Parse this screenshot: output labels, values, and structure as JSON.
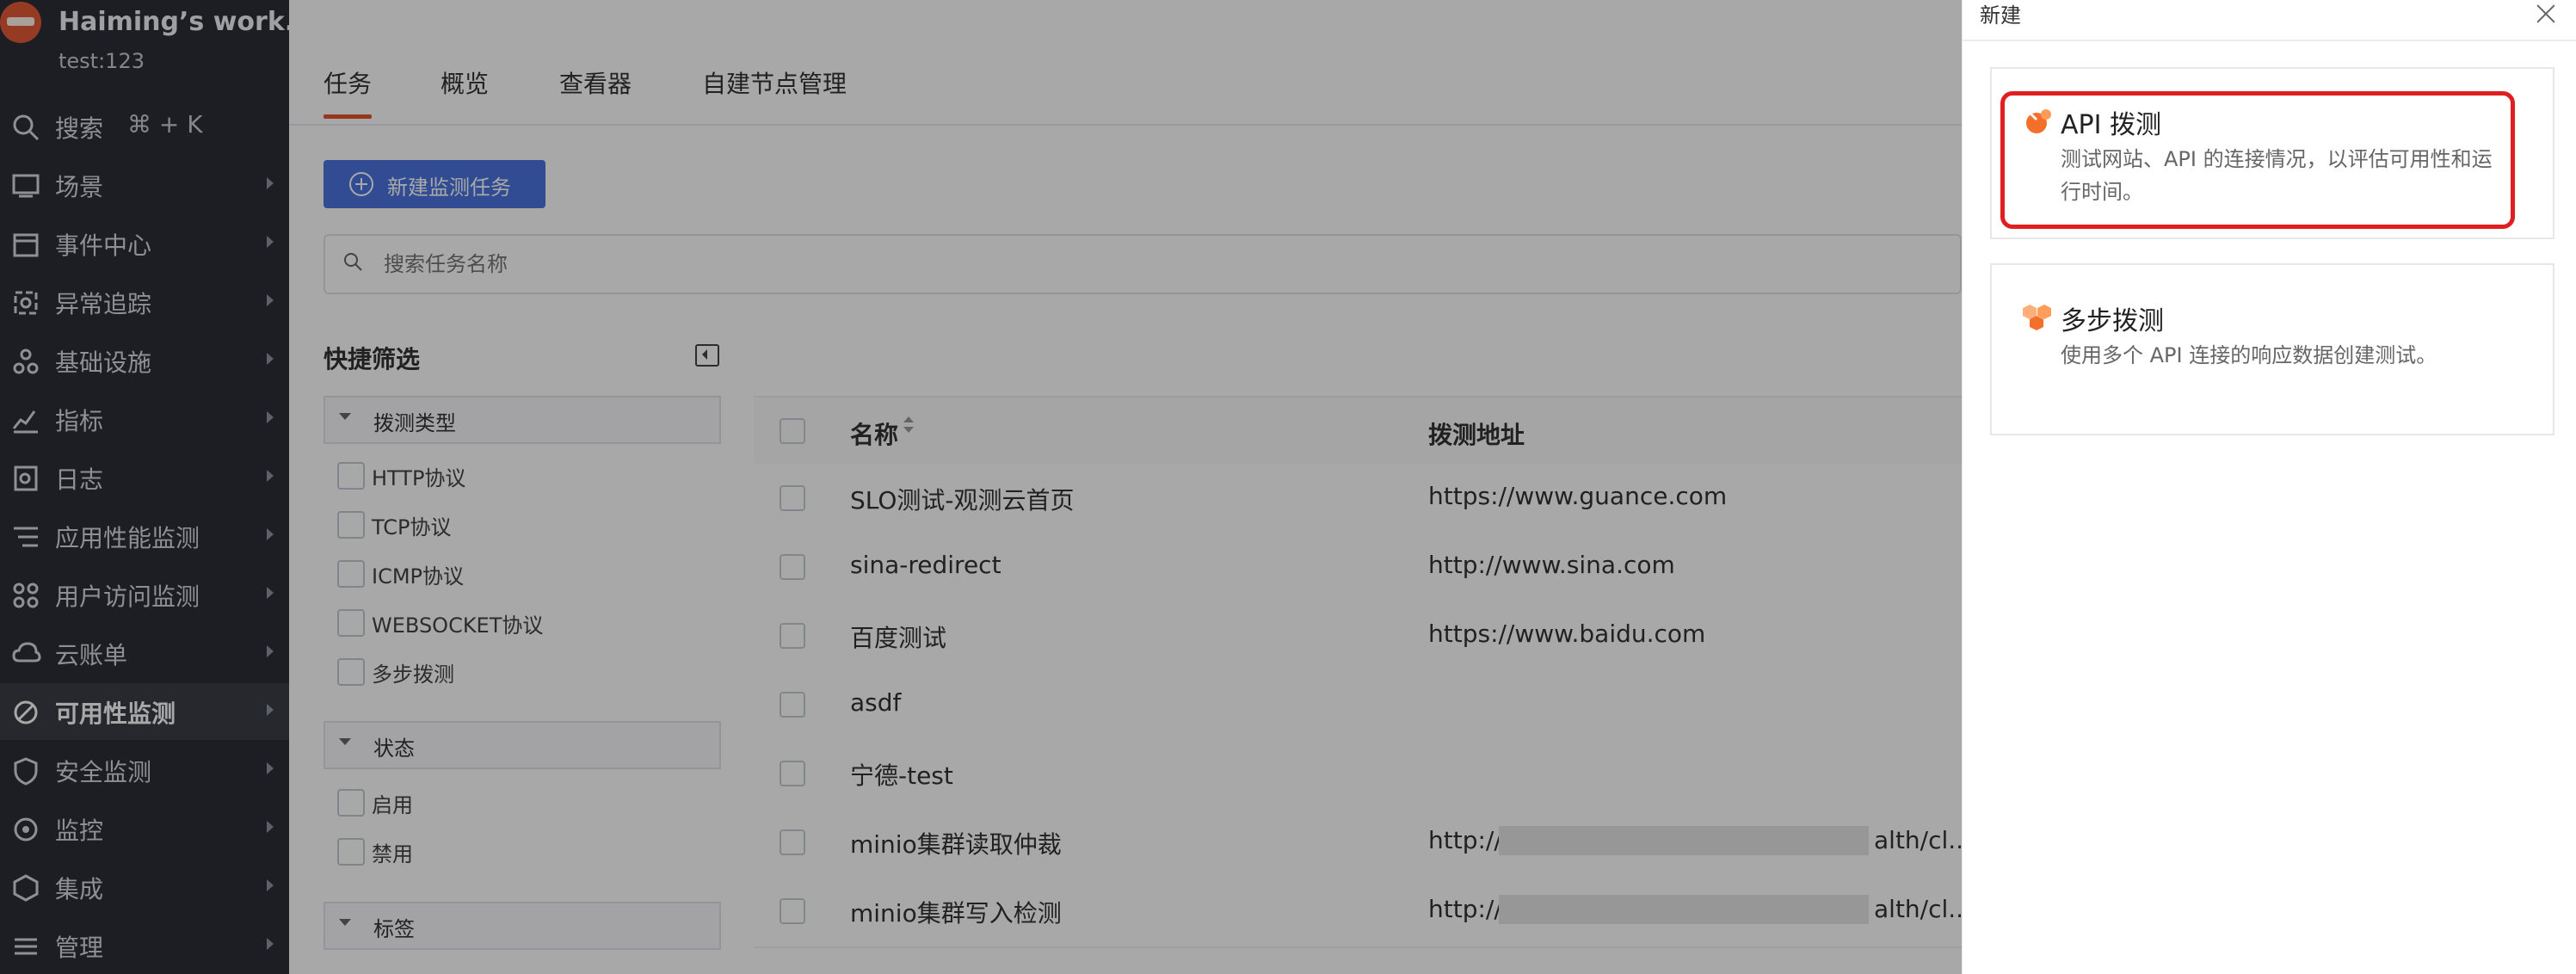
{
  "workspace": {
    "name": "Haiming’s work...",
    "subtitle": "test:123"
  },
  "sidebar": {
    "search": {
      "label": "搜索",
      "shortcut": "⌘ + K"
    },
    "items": [
      {
        "label": "场景",
        "icon": "scene-icon"
      },
      {
        "label": "事件中心",
        "icon": "calendar-icon"
      },
      {
        "label": "异常追踪",
        "icon": "bug-target-icon"
      },
      {
        "label": "基础设施",
        "icon": "infrastructure-icon"
      },
      {
        "label": "指标",
        "icon": "chart-icon"
      },
      {
        "label": "日志",
        "icon": "log-icon"
      },
      {
        "label": "应用性能监测",
        "icon": "apm-icon"
      },
      {
        "label": "用户访问监测",
        "icon": "rum-icon"
      },
      {
        "label": "云账单",
        "icon": "cloud-bill-icon"
      },
      {
        "label": "可用性监测",
        "icon": "availability-icon",
        "active": true
      },
      {
        "label": "安全监测",
        "icon": "shield-icon"
      },
      {
        "label": "监控",
        "icon": "monitor-icon"
      },
      {
        "label": "集成",
        "icon": "integration-icon"
      },
      {
        "label": "管理",
        "icon": "settings-icon"
      }
    ]
  },
  "main": {
    "tabs": [
      "任务",
      "概览",
      "查看器",
      "自建节点管理"
    ],
    "new_task_button": "新建监测任务",
    "search_placeholder": "搜索任务名称",
    "filters": {
      "title": "快捷筛选",
      "groups": [
        {
          "label": "拨测类型",
          "options": [
            "HTTP协议",
            "TCP协议",
            "ICMP协议",
            "WEBSOCKET协议",
            "多步拨测"
          ]
        },
        {
          "label": "状态",
          "options": [
            "启用",
            "禁用"
          ]
        },
        {
          "label": "标签",
          "options": []
        }
      ]
    },
    "table": {
      "columns": [
        "名称",
        "拨测地址"
      ],
      "rows": [
        {
          "name": "SLO测试-观测云首页",
          "address": "https://www.guance.com"
        },
        {
          "name": "sina-redirect",
          "address": "http://www.sina.com"
        },
        {
          "name": "百度测试",
          "address": "https://www.baidu.com"
        },
        {
          "name": "asdf",
          "address": ""
        },
        {
          "name": "宁德-test",
          "address": ""
        },
        {
          "name": "minio集群读取仲裁",
          "address_prefix": "http://",
          "address_suffix": "alth/cl..."
        },
        {
          "name": "minio集群写入检测",
          "address_prefix": "http://",
          "address_suffix": "alth/cl..."
        }
      ]
    }
  },
  "drawer": {
    "title": "新建",
    "options": [
      {
        "title": "API 拨测",
        "description": "测试网站、API 的连接情况，以评估可用性和运行时间。",
        "icon": "api-dial-test-icon"
      },
      {
        "title": "多步拨测",
        "description": "使用多个 API 连接的响应数据创建测试。",
        "icon": "multi-step-dial-test-icon"
      }
    ]
  },
  "colors": {
    "accent": "#e2552d",
    "primary_button": "#4b74e0",
    "sidebar_bg": "#2b2e36",
    "highlight_outline": "#e02020"
  }
}
